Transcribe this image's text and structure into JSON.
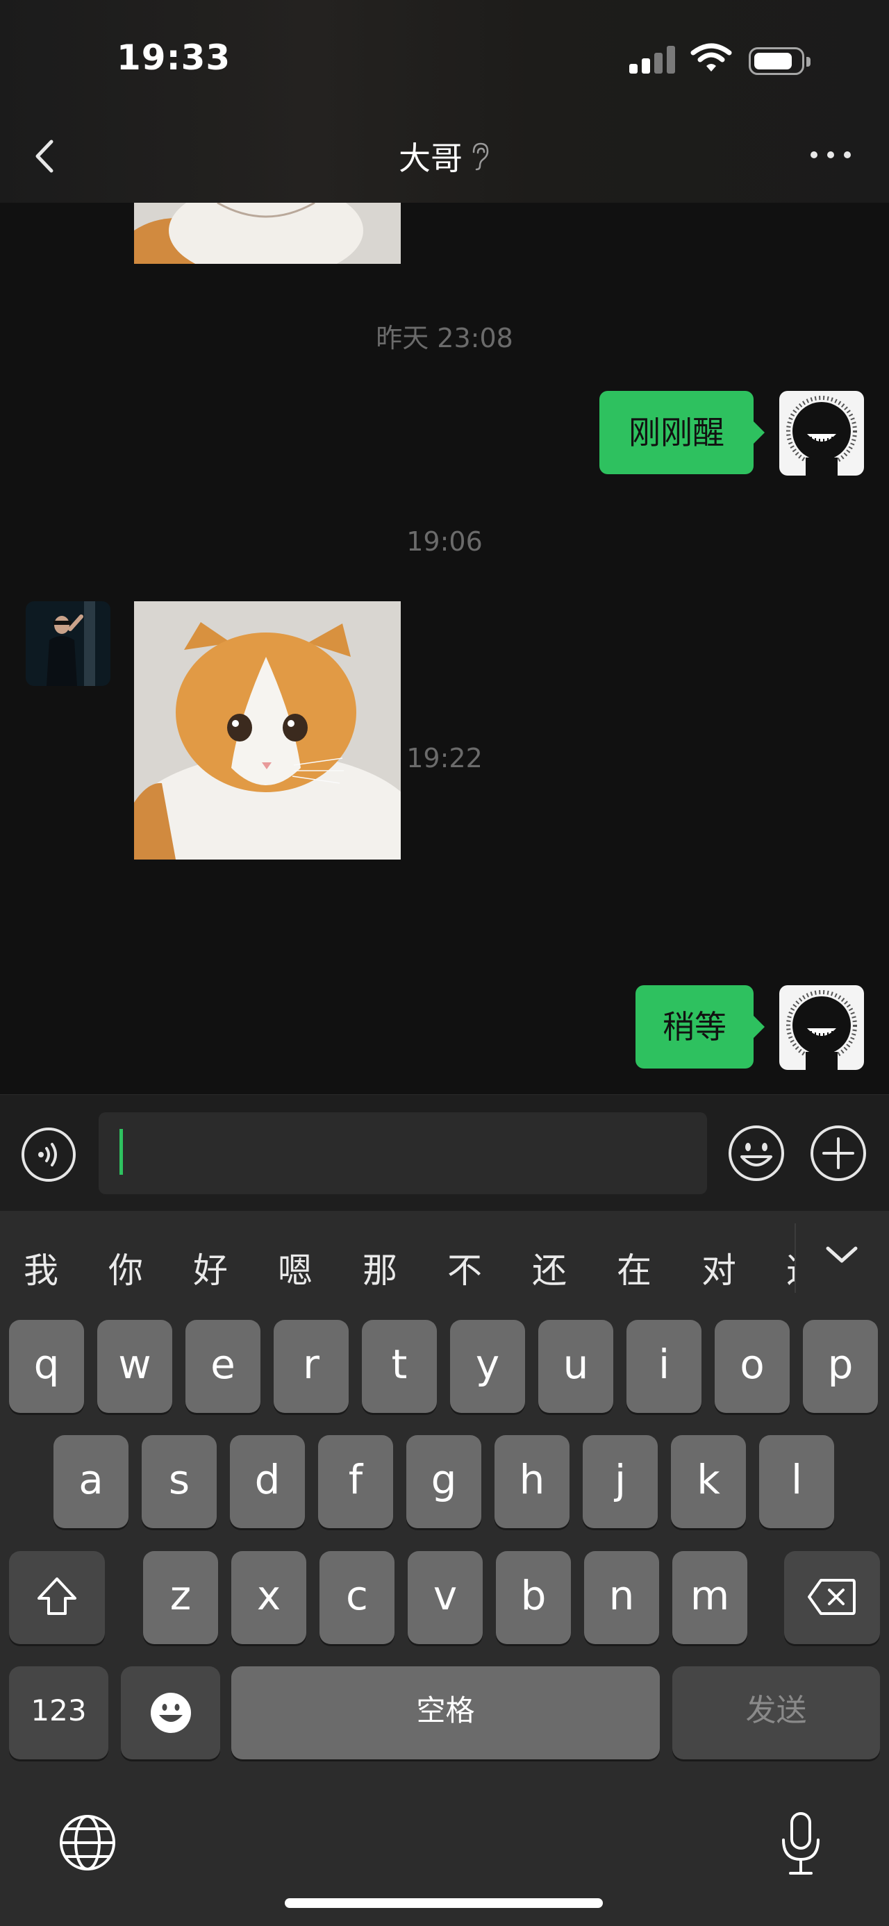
{
  "status_bar": {
    "time": "19:33"
  },
  "nav": {
    "title": "大哥",
    "back_icon": "chevron-left-icon",
    "more_icon": "ellipsis-icon",
    "title_icon": "ear-icon"
  },
  "chat": {
    "timestamps": [
      "昨天 23:08",
      "19:06",
      "19:22"
    ],
    "messages": [
      {
        "from": "other",
        "type": "image",
        "content": "cat-sticker"
      },
      {
        "from": "me",
        "type": "text",
        "text": "刚刚醒"
      },
      {
        "from": "other",
        "type": "image",
        "content": "cat-sticker"
      },
      {
        "from": "me",
        "type": "text",
        "text": "稍等"
      }
    ]
  },
  "input_bar": {
    "value": "",
    "voice_icon": "voice-icon",
    "emoji_icon": "emoji-icon",
    "plus_icon": "plus-icon"
  },
  "keyboard": {
    "candidates": [
      "我",
      "你",
      "好",
      "嗯",
      "那",
      "不",
      "还",
      "在",
      "对",
      "这"
    ],
    "row1": [
      "q",
      "w",
      "e",
      "r",
      "t",
      "y",
      "u",
      "i",
      "o",
      "p"
    ],
    "row2": [
      "a",
      "s",
      "d",
      "f",
      "g",
      "h",
      "j",
      "k",
      "l"
    ],
    "row3": [
      "z",
      "x",
      "c",
      "v",
      "b",
      "n",
      "m"
    ],
    "numbers_label": "123",
    "space_label": "空格",
    "send_label": "发送"
  },
  "colors": {
    "accent": "#2ec15f",
    "background": "#111111",
    "key": "#6b6b6b"
  }
}
